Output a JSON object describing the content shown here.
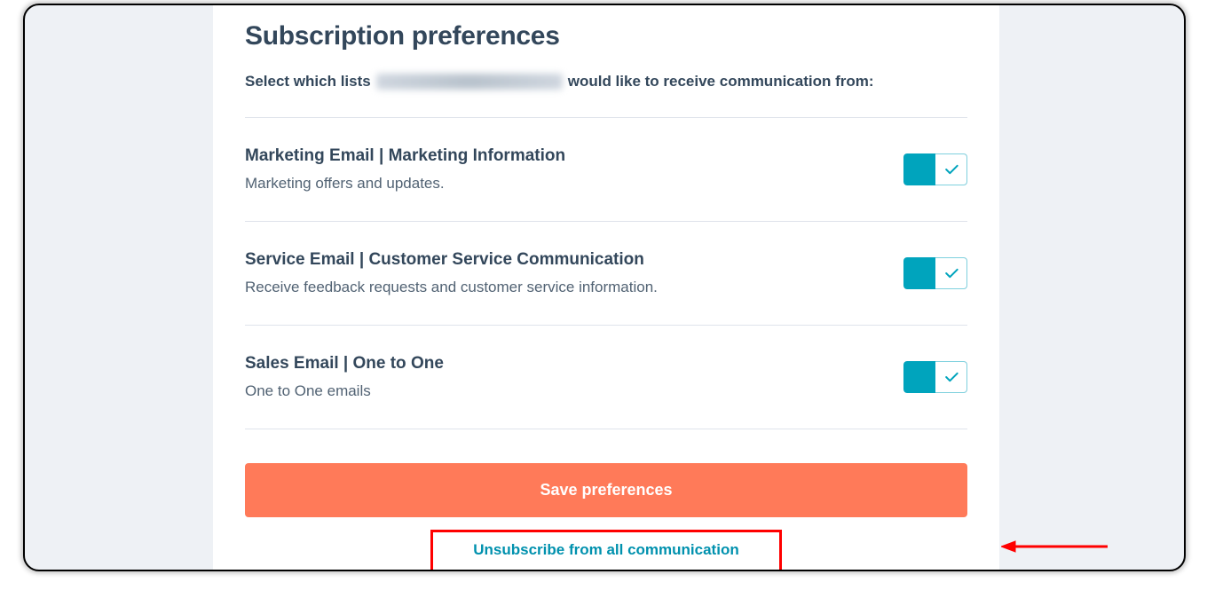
{
  "page": {
    "title": "Subscription preferences",
    "intro_before": "Select which lists",
    "intro_after": "would like to receive communication from:"
  },
  "preferences": [
    {
      "title": "Marketing Email | Marketing Information",
      "desc": "Marketing offers and updates.",
      "on": true
    },
    {
      "title": "Service Email | Customer Service Communication",
      "desc": "Receive feedback requests and customer service information.",
      "on": true
    },
    {
      "title": "Sales Email | One to One",
      "desc": "One to One emails",
      "on": true
    }
  ],
  "actions": {
    "save_label": "Save preferences",
    "unsubscribe_label": "Unsubscribe from all communication"
  }
}
